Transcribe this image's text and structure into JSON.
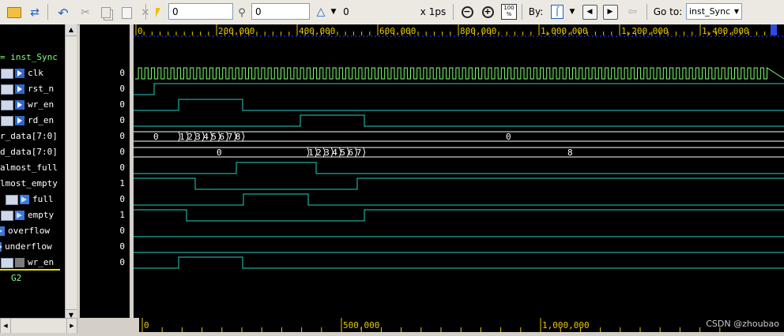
{
  "toolbar": {
    "time_field_1": "0",
    "time_field_2": "0",
    "delta_label": "0",
    "scale_label": "x 1ps",
    "zoom_full_label": "100 %",
    "by_label": "By:",
    "goto_label": "Go to:",
    "goto_value": "inst_Sync"
  },
  "signals": [
    {
      "label": "= inst_Sync",
      "icon": "group",
      "value": ""
    },
    {
      "label": "clk",
      "icon": "input",
      "value": "0"
    },
    {
      "label": "rst_n",
      "icon": "input",
      "value": "0"
    },
    {
      "label": "wr_en",
      "icon": "input",
      "value": "0"
    },
    {
      "label": "rd_en",
      "icon": "input",
      "value": "0"
    },
    {
      "label": "r_data[7:0]",
      "icon": "none",
      "value": "0"
    },
    {
      "label": "d_data[7:0]",
      "icon": "none",
      "value": "0"
    },
    {
      "label": "almost_full",
      "icon": "none",
      "value": "0"
    },
    {
      "label": "lmost_empty",
      "icon": "none",
      "value": "1"
    },
    {
      "label": "full",
      "icon": "output",
      "value": "0"
    },
    {
      "label": "empty",
      "icon": "output",
      "value": "1"
    },
    {
      "label": "overflow",
      "icon": "output_cut",
      "value": "0"
    },
    {
      "label": "underflow",
      "icon": "output_cut",
      "value": "0"
    },
    {
      "label": "wr_en",
      "icon": "watch",
      "value": "0"
    }
  ],
  "group_label": "G2",
  "timeline_top": [
    "0",
    "200,000",
    "400,000",
    "600,000",
    "800,000",
    "1,000,000",
    "1,200,000",
    "1,400,000"
  ],
  "timeline_bottom": [
    "0",
    "500,000",
    "1,000,000"
  ],
  "bus_labels": {
    "wdata_start": "0",
    "wdata_seq": "12345678",
    "wdata_end": "0",
    "rdata_start": "0",
    "rdata_seq": "1234567",
    "rdata_end": "8"
  },
  "watermark": "CSDN @zhoubao"
}
